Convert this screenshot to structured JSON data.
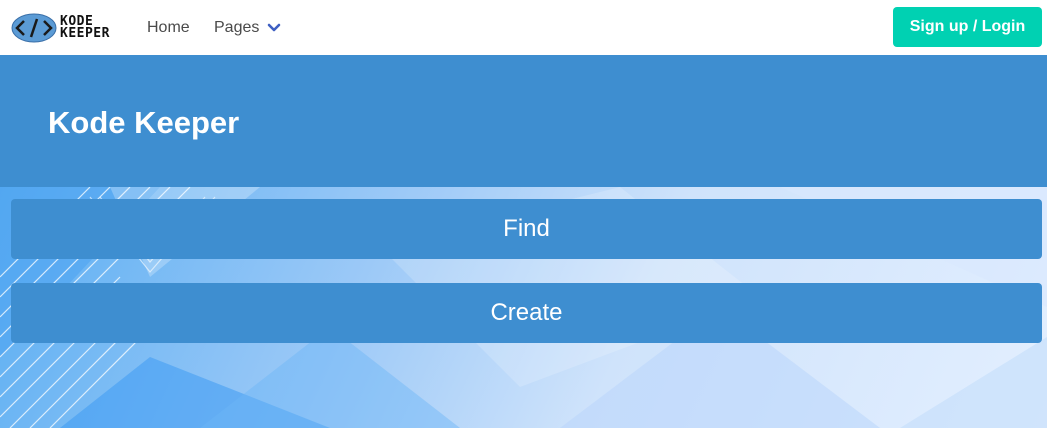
{
  "brand": {
    "line1": "KODE",
    "line2": "KEEPER",
    "icon": "code-brackets-logo-icon"
  },
  "nav": {
    "home_label": "Home",
    "pages_label": "Pages",
    "pages_icon": "chevron-down-icon"
  },
  "auth": {
    "signup_label": "Sign up / Login"
  },
  "hero": {
    "title": "Kode Keeper"
  },
  "actions": {
    "find_label": "Find",
    "create_label": "Create"
  },
  "colors": {
    "primary": "#3e8ed0",
    "accent": "#00d1b2",
    "nav_text": "#4a4a4a"
  }
}
